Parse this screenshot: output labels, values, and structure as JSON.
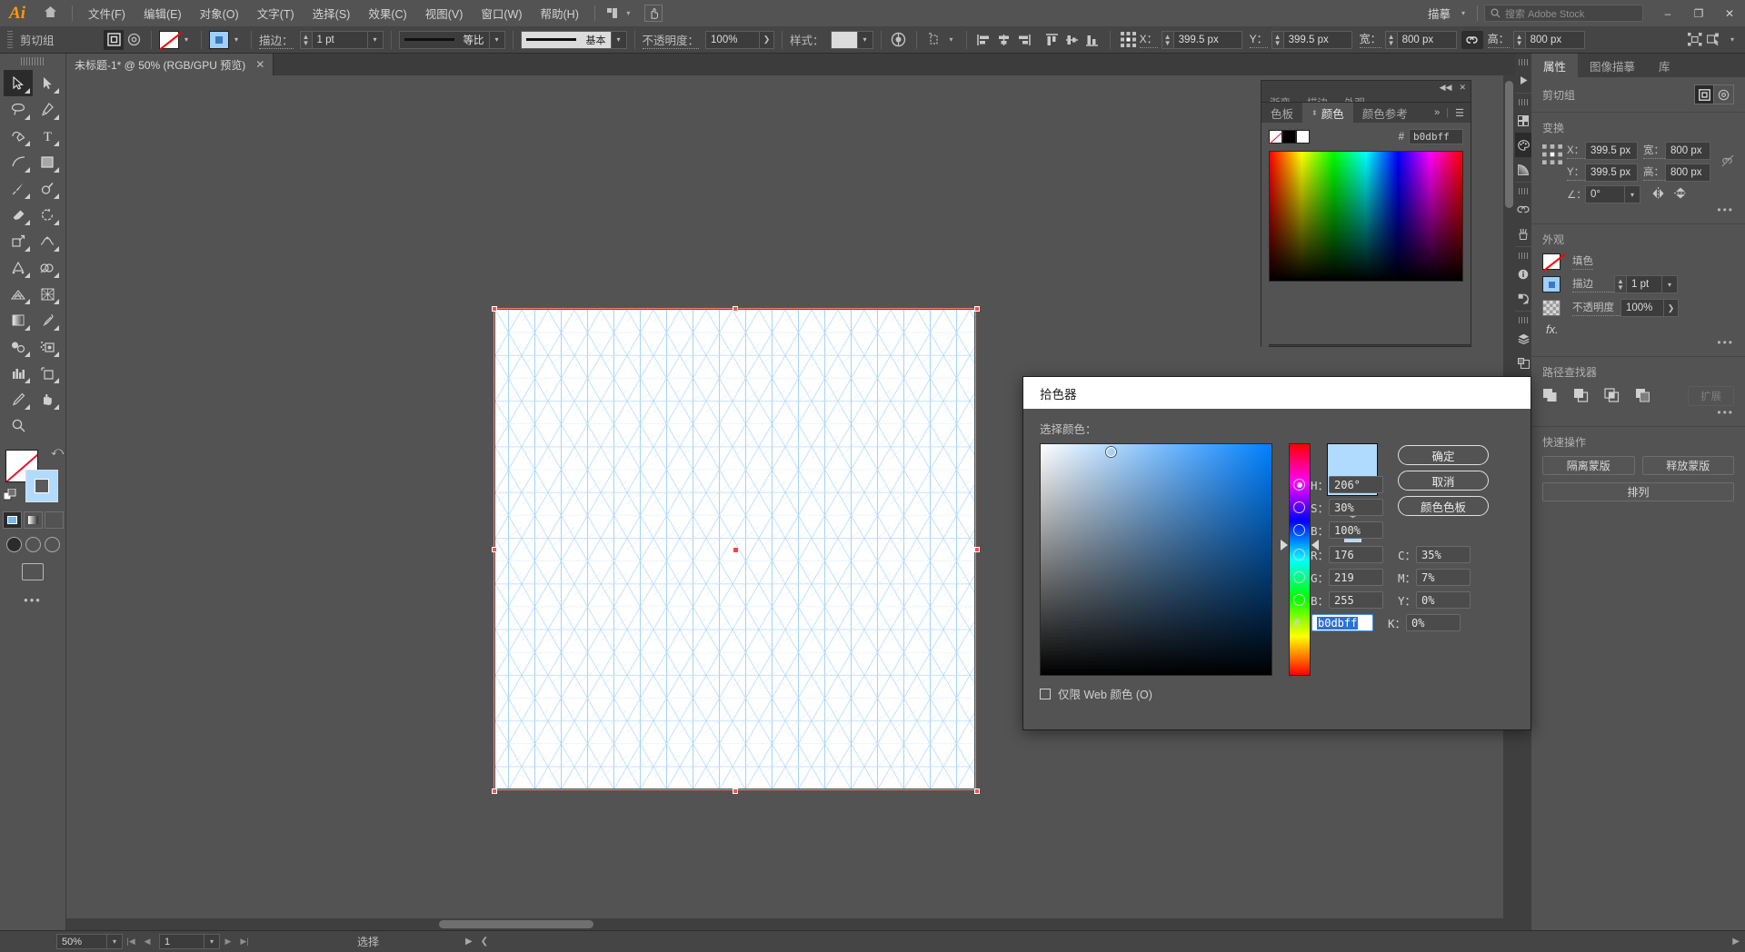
{
  "app": {
    "logo": "Ai",
    "home_icon": "home-icon",
    "workspace": "描摹",
    "search_placeholder": "搜索 Adobe Stock",
    "window_buttons": {
      "minimize": "–",
      "restore": "❐",
      "close": "✕"
    }
  },
  "menu": {
    "items": [
      {
        "label": "文件(F)"
      },
      {
        "label": "编辑(E)"
      },
      {
        "label": "对象(O)"
      },
      {
        "label": "文字(T)"
      },
      {
        "label": "选择(S)"
      },
      {
        "label": "效果(C)"
      },
      {
        "label": "视图(V)"
      },
      {
        "label": "窗口(W)"
      },
      {
        "label": "帮助(H)"
      }
    ]
  },
  "control_bar": {
    "selection_label": "剪切组",
    "stroke_label": "描边：",
    "stroke_weight": "1 pt",
    "stroke_profile": "等比",
    "brush_profile": "基本",
    "opacity_label": "不透明度：",
    "opacity_value": "100%",
    "style_label": "样式：",
    "x_label": "X：",
    "x_value": "399.5 px",
    "y_label": "Y：",
    "y_value": "399.5 px",
    "w_label": "宽：",
    "w_value": "800 px",
    "h_label": "高：",
    "h_value": "800 px"
  },
  "document": {
    "tab_title": "未标题-1* @ 50% (RGB/GPU 预览)",
    "close": "✕"
  },
  "status_bar": {
    "zoom": "50%",
    "page": "1",
    "tool_status": "选择"
  },
  "toolbar": {
    "tools": [
      {
        "name": "selection-tool",
        "selected": true
      },
      {
        "name": "direct-selection-tool",
        "selected": false
      },
      {
        "name": "lasso-tool",
        "selected": false
      },
      {
        "name": "pen-tool",
        "selected": false
      },
      {
        "name": "curvature-tool",
        "selected": false
      },
      {
        "name": "type-tool",
        "selected": false
      },
      {
        "name": "line-segment-tool",
        "selected": false
      },
      {
        "name": "rectangle-tool",
        "selected": false
      },
      {
        "name": "paintbrush-tool",
        "selected": false
      },
      {
        "name": "shaper-tool",
        "selected": false
      },
      {
        "name": "eraser-tool",
        "selected": false
      },
      {
        "name": "rotate-tool",
        "selected": false
      },
      {
        "name": "scale-tool",
        "selected": false
      },
      {
        "name": "width-tool",
        "selected": false
      },
      {
        "name": "free-transform-tool",
        "selected": false
      },
      {
        "name": "shape-builder-tool",
        "selected": false
      },
      {
        "name": "perspective-grid-tool",
        "selected": false
      },
      {
        "name": "mesh-tool",
        "selected": false
      },
      {
        "name": "gradient-tool",
        "selected": false
      },
      {
        "name": "eyedropper-tool",
        "selected": false
      },
      {
        "name": "blend-tool",
        "selected": false
      },
      {
        "name": "symbol-sprayer-tool",
        "selected": false
      },
      {
        "name": "column-graph-tool",
        "selected": false
      },
      {
        "name": "artboard-tool",
        "selected": false
      },
      {
        "name": "slice-tool",
        "selected": false
      },
      {
        "name": "hand-tool",
        "selected": false
      },
      {
        "name": "zoom-tool",
        "selected": false
      }
    ],
    "fill_color": "none",
    "stroke_color": "#b0dbff"
  },
  "right_rail": {
    "icons": [
      "play-icon",
      "swatches-icon",
      "color-palette-icon",
      "gradient-icon",
      "links-icon",
      "brushes-icon",
      "info-icon",
      "symbols-icon",
      "layers-icon",
      "artboards-icon"
    ]
  },
  "properties_panel": {
    "tabs": [
      {
        "label": "属性",
        "active": true
      },
      {
        "label": "图像描摹",
        "active": false
      },
      {
        "label": "库",
        "active": false
      }
    ],
    "object_type": "剪切组",
    "transform": {
      "title": "变换",
      "x_label": "X：",
      "x_value": "399.5 px",
      "y_label": "Y：",
      "y_value": "399.5 px",
      "w_label": "宽：",
      "w_value": "800 px",
      "h_label": "高：",
      "h_value": "800 px",
      "angle_label": "∠：",
      "angle_value": "0°"
    },
    "appearance": {
      "title": "外观",
      "fill_label": "填色",
      "stroke_label": "描边",
      "stroke_weight": "1 pt",
      "opacity_label": "不透明度",
      "opacity_value": "100%",
      "fx_label": "fx."
    },
    "pathfinder": {
      "title": "路径查找器",
      "expand": "扩展"
    },
    "quick_actions": {
      "title": "快速操作",
      "buttons": [
        "隔离蒙版",
        "释放蒙版",
        "排列"
      ]
    },
    "more": "•••"
  },
  "color_panel": {
    "tabs": [
      {
        "label": "色板",
        "active": false
      },
      {
        "label": "颜色",
        "active": true
      },
      {
        "label": "颜色参考",
        "active": false
      }
    ],
    "behind_tabs": [
      "渐变",
      "描边",
      "外观"
    ],
    "hash": "#",
    "hex": "b0dbff",
    "collapse": "»",
    "menu": "☰"
  },
  "color_picker": {
    "title": "拾色器",
    "subtitle": "选择颜色：",
    "buttons": {
      "ok": "确定",
      "cancel": "取消",
      "swatches": "颜色色板"
    },
    "web_only_label": "仅限 Web 颜色 (O)",
    "web_only_checked": false,
    "hash": "#",
    "hex": "b0dbff",
    "preview_color": "#b0dbff",
    "selected_mode": "H",
    "hsb": [
      {
        "key": "H：",
        "value": "206°",
        "selected": true
      },
      {
        "key": "S：",
        "value": "30%",
        "selected": false
      },
      {
        "key": "B：",
        "value": "100%",
        "selected": false
      }
    ],
    "rgb": [
      {
        "key": "R：",
        "value": "176",
        "selected": false
      },
      {
        "key": "G：",
        "value": "219",
        "selected": false
      },
      {
        "key": "B：",
        "value": "255",
        "selected": false
      }
    ],
    "cmyk": [
      {
        "key": "C：",
        "value": "35%"
      },
      {
        "key": "M：",
        "value": "7%"
      },
      {
        "key": "Y：",
        "value": "0%"
      },
      {
        "key": "K：",
        "value": "0%"
      }
    ]
  },
  "artwork": {
    "description": "isometric-triangular-grid",
    "grid_color": "#bcdcfa",
    "background": "#ffffff",
    "selection_color": "#ff7878"
  }
}
